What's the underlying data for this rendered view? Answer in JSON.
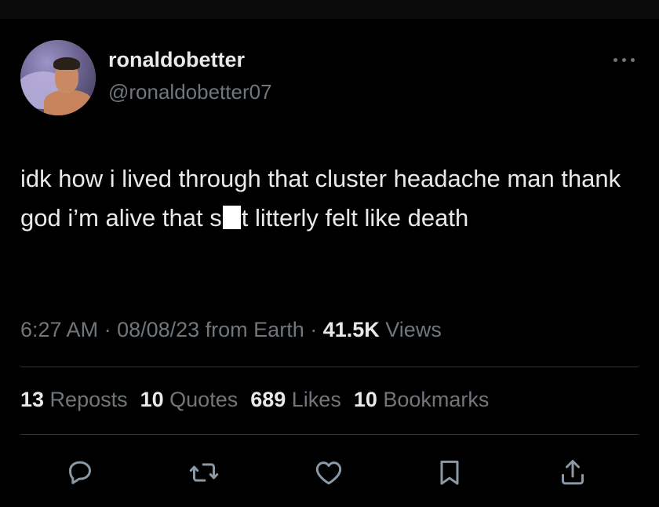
{
  "user": {
    "display_name": "ronaldobetter",
    "handle": "@ronaldobetter07"
  },
  "tweet": {
    "text_part1": "idk how i lived through that cluster headache man thank god i’m alive that s",
    "text_part2": "t litterly felt like death"
  },
  "meta": {
    "time": "6:27 AM",
    "sep1": " · ",
    "date": "08/08/23",
    "source": " from Earth",
    "sep2": " · ",
    "views_count": "41.5K",
    "views_label": " Views"
  },
  "stats": {
    "reposts_count": "13",
    "reposts_label": " Reposts",
    "quotes_count": "10",
    "quotes_label": " Quotes",
    "likes_count": "689",
    "likes_label": " Likes",
    "bookmarks_count": "10",
    "bookmarks_label": " Bookmarks"
  },
  "actions": [
    "reply-icon",
    "repost-icon",
    "like-icon",
    "bookmark-icon",
    "share-icon"
  ],
  "colors": {
    "background": "#000000",
    "text": "#e7e9ea",
    "secondary": "#71767b",
    "divider": "#2f3336"
  }
}
